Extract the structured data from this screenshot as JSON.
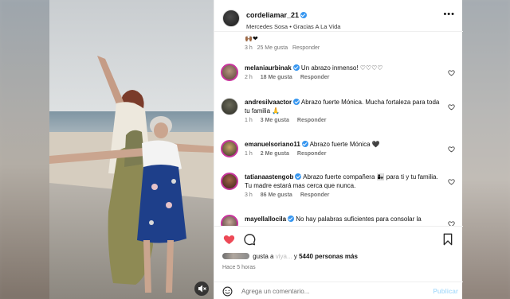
{
  "post": {
    "username": "cordeliamar_21",
    "audio": {
      "artist": "Mercedes Sosa",
      "separator": "•",
      "track": "Gracias A La Vida"
    },
    "more_label": "•••"
  },
  "top_comment_fragment": {
    "text": "🙌🏾❤",
    "time": "3 h",
    "likes": "25 Me gusta",
    "reply": "Responder"
  },
  "comments": [
    {
      "username": "melaniaurbinak",
      "verified": true,
      "text": "Un abrazo inmenso! ♡♡♡♡",
      "time": "2 h",
      "likes": "18 Me gusta",
      "reply": "Responder"
    },
    {
      "username": "andresilvaactor",
      "verified": true,
      "text": "Abrazo fuerte Mónica. Mucha fortaleza para toda tu familia 🙏",
      "time": "1 h",
      "likes": "3 Me gusta",
      "reply": "Responder"
    },
    {
      "username": "emanuelsoriano11",
      "verified": true,
      "text": "Abrazo fuerte Mónica 🖤",
      "time": "1 h",
      "likes": "2 Me gusta",
      "reply": "Responder"
    },
    {
      "username": "tatianaastengob",
      "verified": true,
      "text": "Abrazo fuerte compañera 👩‍👧 para ti y tu familia. Tu madre estará mas cerca que nunca.",
      "time": "3 h",
      "likes": "86 Me gusta",
      "reply": "Responder"
    },
    {
      "username": "mayellallocila",
      "verified": true,
      "text": "No hay palabras suficientes para consolar la",
      "time": "",
      "likes": "",
      "reply": ""
    }
  ],
  "likes_summary": {
    "prefix": "gusta a",
    "blurred_name": "viya...",
    "middle": "y",
    "count": "5440 personas más"
  },
  "posted_ago": "Hace 5 horas",
  "add_comment": {
    "placeholder": "Agrega un comentario...",
    "post_label": "Publicar"
  },
  "colors": {
    "like_red": "#ed4956",
    "verified_blue": "#3897f0",
    "post_disabled": "#b2dffc",
    "story_ring": "#c8359d"
  },
  "icons": [
    "more-icon",
    "heart-filled-icon",
    "comment-icon",
    "bookmark-icon",
    "emoji-icon",
    "audio-muted-icon",
    "heart-outline-icon"
  ]
}
